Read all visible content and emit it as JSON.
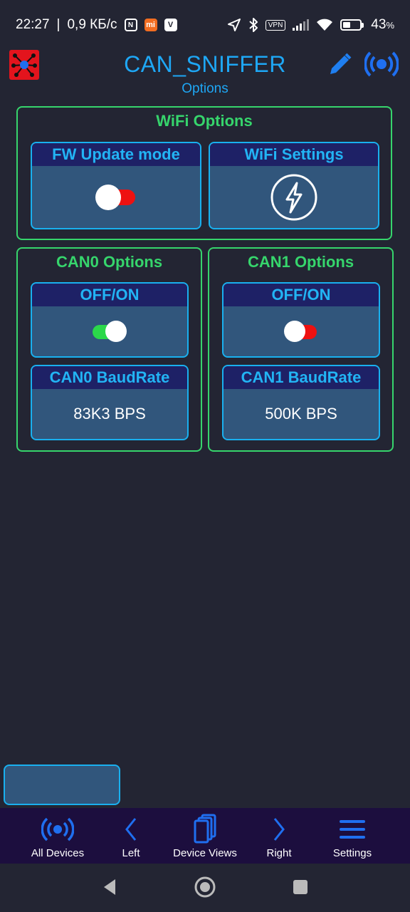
{
  "status_bar": {
    "time": "22:27",
    "speed": "0,9 КБ/с",
    "vpn": "VPN",
    "battery": "43",
    "battery_unit": "%",
    "battery_level": 0.43,
    "icons": [
      "nfc-icon",
      "mi-app-icon",
      "app-v-icon",
      "location-icon",
      "bluetooth-icon",
      "vpn-icon",
      "signal-icon",
      "wifi-icon",
      "battery-icon"
    ]
  },
  "header": {
    "title": "CAN_SNIFFER",
    "subtitle": "Options",
    "logo_icon": "network-logo-icon",
    "edit_icon": "pencil-icon",
    "broadcast_icon": "broadcast-icon"
  },
  "wifi_panel": {
    "title": "WiFi Options",
    "fw_update": {
      "label": "FW Update mode",
      "state": "off"
    },
    "wifi_settings": {
      "label": "WiFi Settings",
      "icon": "lightning-icon"
    }
  },
  "can0_panel": {
    "title": "CAN0 Options",
    "toggle": {
      "label": "OFF/ON",
      "state": "on"
    },
    "baudrate": {
      "label": "CAN0 BaudRate",
      "value": "83K3 BPS"
    }
  },
  "can1_panel": {
    "title": "CAN1 Options",
    "toggle": {
      "label": "OFF/ON",
      "state": "off"
    },
    "baudrate": {
      "label": "CAN1 BaudRate",
      "value": "500K BPS"
    }
  },
  "bottom_nav": {
    "items": [
      {
        "label": "All Devices",
        "icon": "broadcast-icon"
      },
      {
        "label": "Left",
        "icon": "chevron-left-icon"
      },
      {
        "label": "Device Views",
        "icon": "pages-icon"
      },
      {
        "label": "Right",
        "icon": "chevron-right-icon"
      },
      {
        "label": "Settings",
        "icon": "menu-icon"
      }
    ]
  },
  "colors": {
    "background": "#232533",
    "accent_blue": "#1ea7f5",
    "accent_green": "#36d56c",
    "card": "#31567c",
    "card_header": "#1e2166",
    "nav_bar": "#1c0e3e",
    "toggle_on": "#2bd84a",
    "toggle_off": "#ee1111",
    "logo_red": "#e3141d"
  }
}
